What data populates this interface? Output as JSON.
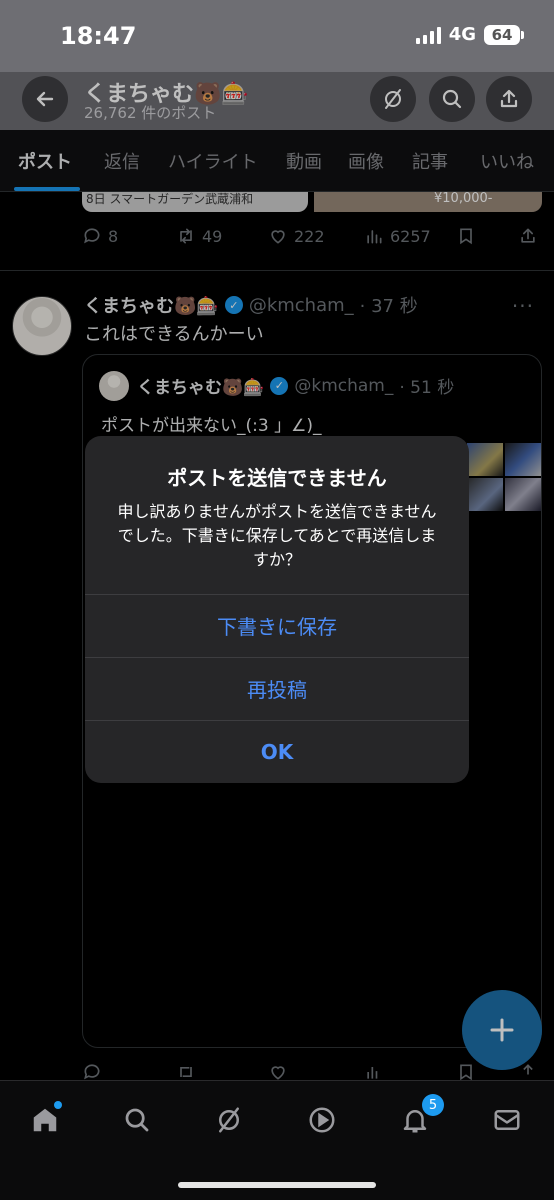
{
  "status_bar": {
    "time": "18:47",
    "network": "4G",
    "battery": "64"
  },
  "header": {
    "title": "くまちゃむ🐻🎰",
    "subtitle": "26,762 件のポスト"
  },
  "tabs": [
    {
      "label": "ポスト",
      "active": true
    },
    {
      "label": "返信"
    },
    {
      "label": "ハイライト"
    },
    {
      "label": "動画"
    },
    {
      "label": "画像"
    },
    {
      "label": "記事"
    },
    {
      "label": "いいね"
    }
  ],
  "previous_post": {
    "card_left_text": "8日 スマートガーデン武蔵浦和",
    "card_right_text": "¥10,000-",
    "replies": "8",
    "reposts": "49",
    "likes": "222",
    "views": "6257"
  },
  "post": {
    "name": "くまちゃむ🐻🎰",
    "handle": "@kmcham_",
    "time": "· 37 秒",
    "text": "これはできるんかーい",
    "more": "···",
    "quote": {
      "name": "くまちゃむ🐻🎰",
      "handle": "@kmcham_",
      "time": "· 51 秒",
      "text": "ポストが出来ない_(:3 」∠)_"
    }
  },
  "dialog": {
    "title": "ポストを送信できません",
    "message": "申し訳ありませんがポストを送信できませんでした。下書きに保存してあとで再送信しますか？",
    "save_draft": "下書きに保存",
    "repost": "再投稿",
    "ok": "OK"
  },
  "bottom_nav": {
    "notifications_badge": "5"
  },
  "colors": {
    "accent": "#1d9bf0",
    "dialog_button": "#4c8cf6",
    "background": "#000000"
  }
}
